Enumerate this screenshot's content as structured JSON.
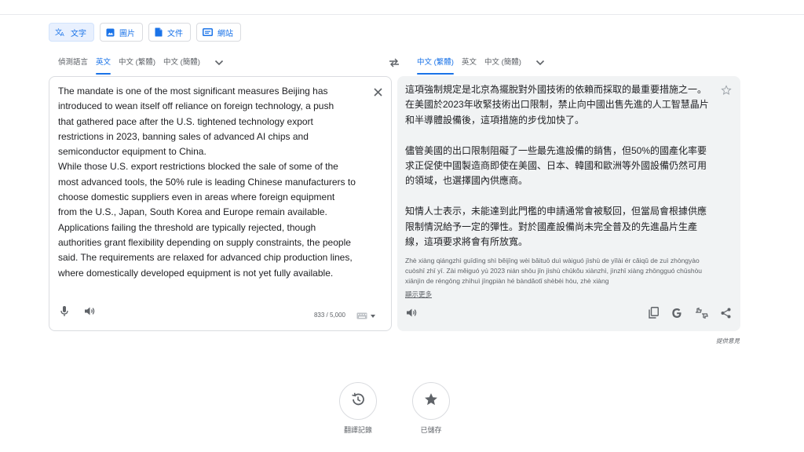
{
  "modes": [
    {
      "label": "文字",
      "icon": "translate-icon",
      "active": true
    },
    {
      "label": "圖片",
      "icon": "image-icon",
      "active": false
    },
    {
      "label": "文件",
      "icon": "document-icon",
      "active": false
    },
    {
      "label": "網站",
      "icon": "website-icon",
      "active": false
    }
  ],
  "source_langs": [
    "偵測語言",
    "英文",
    "中文 (繁體)",
    "中文 (簡體)"
  ],
  "target_langs": [
    "中文 (繁體)",
    "英文",
    "中文 (簡體)"
  ],
  "source": {
    "text": "The mandate is one of the most significant measures Beijing has\nintroduced to wean itself off reliance on foreign technology, a push\nthat gathered pace after the U.S. tightened technology export\nrestrictions in 2023, banning sales of advanced AI chips and\nsemiconductor equipment to China.\nWhile those U.S. export restrictions blocked the sale of some of the\nmost advanced tools, the 50% rule is leading Chinese manufacturers to\nchoose domestic suppliers even in areas where foreign equipment\nfrom the U.S., Japan, South Korea and Europe remain available.\nApplications failing the threshold are typically rejected, though\nauthorities grant flexibility depending on supply constraints, the people\nsaid. The requirements are relaxed for advanced chip production lines,\nwhere domestically developed equipment is not yet fully available.",
    "char_count": "833 / 5,000"
  },
  "target": {
    "paragraphs": [
      "這項強制規定是北京為擺脫對外國技術的依賴而採取的最重要措施之一。在美國於2023年收緊技術出口限制，禁止向中國出售先進的人工智慧晶片和半導體設備後，這項措施的步伐加快了。",
      "儘管美國的出口限制阻礙了一些最先進設備的銷售，但50%的國產化率要求正促使中國製造商即使在美國、日本、韓國和歐洲等外國設備仍然可用的領域，也選擇國內供應商。",
      "知情人士表示，未能達到此門檻的申請通常會被駁回，但當局會根據供應限制情況給予一定的彈性。對於國產設備尚未完全普及的先進晶片生產線，這項要求將會有所放寬。"
    ],
    "pinyin": "Zhè xiàng qiángzhì guīdìng shì běijīng wèi bǎituō duì wàiguó jìshù de yīlài ér cǎiqǔ de zuì zhòngyào cuòshī zhī yī. Zài měiguó yú 2023 nián shōu jǐn jìshù chūkǒu xiànzhì, jìnzhǐ xiàng zhōngguó chūshòu xiānjìn de réngōng zhìhuì jīngpiàn hé bàndǎotǐ shèbèi hòu, zhè xiàng",
    "show_more": "顯示更多",
    "feedback": "提供意見"
  },
  "bottom": {
    "history_label": "翻譯記錄",
    "saved_label": "已儲存"
  },
  "colors": {
    "accent": "#1a73e8",
    "text": "#202124",
    "muted": "#5f6368",
    "target_bg": "#f1f3f4"
  }
}
